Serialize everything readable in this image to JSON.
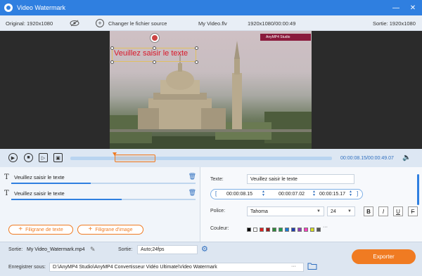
{
  "window": {
    "title": "Video Watermark",
    "minimize": "—",
    "close": "✕"
  },
  "infobar": {
    "original": "Original: 1920x1080",
    "change_source": "Changer le fichier source",
    "file_name": "My Video.flv",
    "file_info": "1920x1080/00:00:49",
    "output": "Sortie: 1920x1080"
  },
  "preview": {
    "watermark_text": "Veuillez saisir le texte",
    "image_watermark_caption": "AnyMP4 Studio"
  },
  "controls": {
    "time_readout": "00:00:08.15/00:00:49.07",
    "selection_start_fraction": 0.17,
    "selection_end_fraction": 0.325
  },
  "layers": [
    {
      "label": "Veuillez saisir le texte",
      "fill_fraction": 0.43
    },
    {
      "label": "Veuillez saisir le texte",
      "fill_fraction": 0.6
    }
  ],
  "buttons": {
    "add_text": "Filigrane de texte",
    "add_image": "Filigrane d'image"
  },
  "settings": {
    "text_label": "Texte:",
    "text_value": "Veuillez saisir le texte",
    "start_time": "00:00:08.15",
    "duration": "00:00:07.02",
    "end_time": "00:00:15.17",
    "font_label": "Police:",
    "font_value": "Tahoma",
    "size_value": "24",
    "bold": "B",
    "italic": "I",
    "underline": "U",
    "strike": "F",
    "color_label": "Couleur:",
    "more": "···",
    "colors": [
      "#000000",
      "#ffffff",
      "#e02020",
      "#a01818",
      "#2e8b3a",
      "#1f9e50",
      "#1a7ad8",
      "#2040b0",
      "#8e3cb8",
      "#ff40c0",
      "#d8e020",
      "#555555"
    ]
  },
  "bottom": {
    "output_label": "Sortie:",
    "output_file": "My Video_Watermark.mp4",
    "format_label": "Sortie:",
    "format_value": "Auto;24fps",
    "save_label": "Enregistrer sous:",
    "save_path": "D:\\AnyMP4 Studio\\AnyMP4 Convertisseur Vidéo Ultimate\\Video Watermark",
    "browse": "···",
    "export": "Exporter"
  }
}
